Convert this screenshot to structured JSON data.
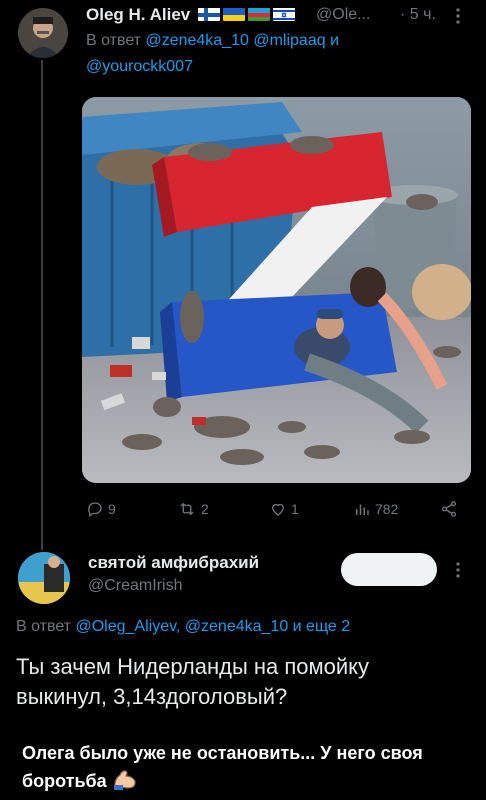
{
  "tweet1": {
    "author_name": "Oleg H. Aliev",
    "handle": "@Ole...",
    "time": "· 5 ч.",
    "reply_prefix": "В ответ",
    "reply_to_line1": "@zene4ka_10 @mlipaaq и",
    "reply_to_line2": "@yourockk007",
    "actions": {
      "replies": "9",
      "retweets": "2",
      "likes": "1",
      "views": "782"
    }
  },
  "tweet2": {
    "author_name": "святой амфибрахий",
    "handle": "@CreamIrish",
    "reply_prefix": "В ответ",
    "reply_to": "@Oleg_Aliyev, @zene4ka_10 и еще 2",
    "text_line1": "Ты зачем Нидерланды на помойку",
    "text_line2": "выкинул, 3,14здоголовый?"
  },
  "caption": {
    "text": "Олега было уже не остановить... У него своя боротьба"
  },
  "icons": {
    "more": "more-icon",
    "reply": "reply-icon",
    "retweet": "retweet-icon",
    "like": "heart-icon",
    "views": "views-icon",
    "share": "share-icon",
    "emoji": "flexed-biceps-emoji"
  },
  "colors": {
    "link": "#1d9bf0",
    "muted": "#71767b",
    "text": "#e7e9ea"
  }
}
